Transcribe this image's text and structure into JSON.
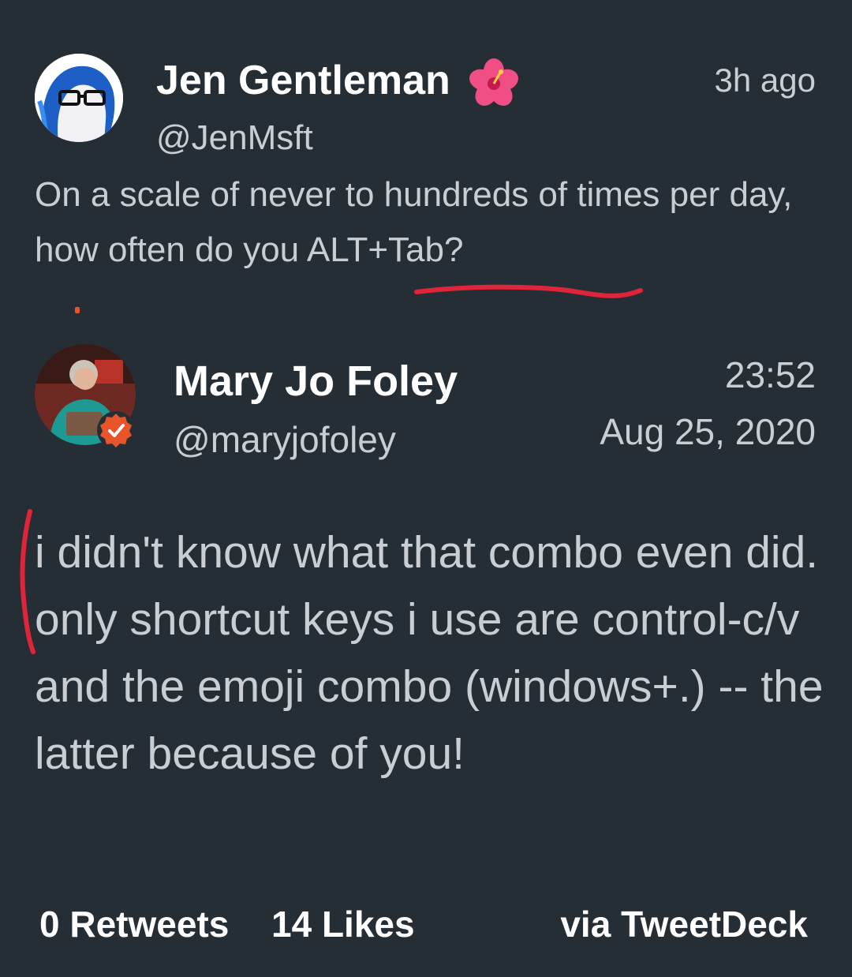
{
  "quoted_tweet": {
    "name": "Jen Gentleman",
    "name_emoji": "hibiscus-icon",
    "handle": "@JenMsft",
    "time": "3h ago",
    "text": "On a scale of never to hundreds of times per day, how often do you ALT+Tab?"
  },
  "tweet": {
    "name": "Mary Jo Foley",
    "handle": "@maryjofoley",
    "time": "23:52",
    "date": "Aug 25, 2020",
    "text": "i didn't know what that combo even did. only shortcut keys i use are control-c/v and the emoji combo (windows+.) -- the latter because of you!",
    "verified_badge": "check-badge-icon"
  },
  "stats": {
    "retweets": "0 Retweets",
    "likes": "14 Likes",
    "source": "via TweetDeck"
  },
  "colors": {
    "background": "#262e35",
    "text": "#c9ced3",
    "name": "#ffffff",
    "annotation": "#e0243a",
    "badge": "#e8552b"
  }
}
